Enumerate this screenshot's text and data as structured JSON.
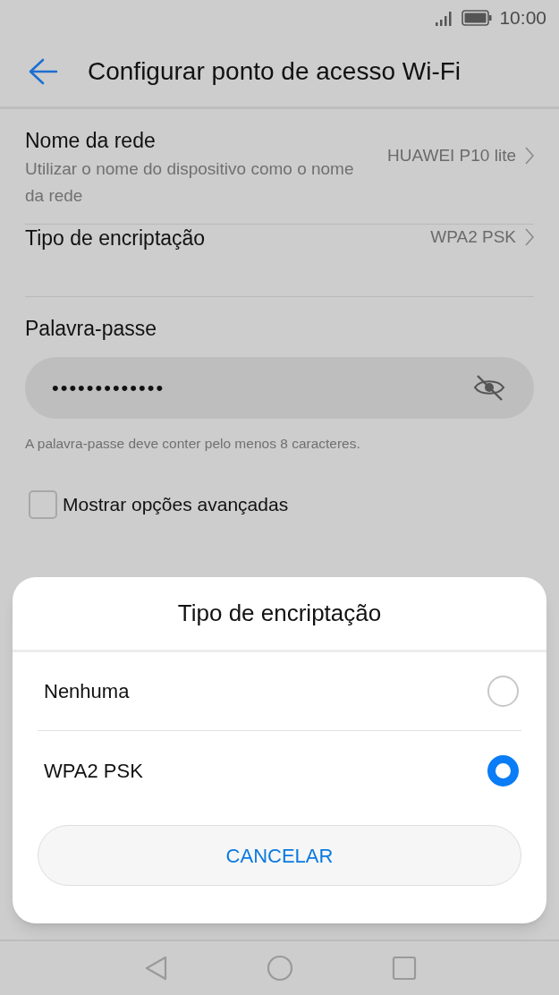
{
  "status_bar": {
    "time": "10:00"
  },
  "header": {
    "title": "Configurar ponto de acesso Wi-Fi"
  },
  "settings": [
    {
      "label": "Nome da rede",
      "description": "Utilizar o nome do dispositivo como o nome da rede",
      "value": "HUAWEI P10 lite"
    },
    {
      "label": "Tipo de encriptação",
      "value": "WPA2 PSK"
    }
  ],
  "password": {
    "label": "Palavra-passe",
    "value": "•••••••••••••",
    "visible": false,
    "hint": "A palavra-passe deve conter pelo menos 8 caracteres."
  },
  "advanced": {
    "label": "Mostrar opções avançadas",
    "checked": false
  },
  "dialog": {
    "title": "Tipo de encriptação",
    "options": [
      {
        "label": "Nenhuma",
        "selected": false
      },
      {
        "label": "WPA2 PSK",
        "selected": true
      }
    ],
    "cancel": "CANCELAR"
  }
}
